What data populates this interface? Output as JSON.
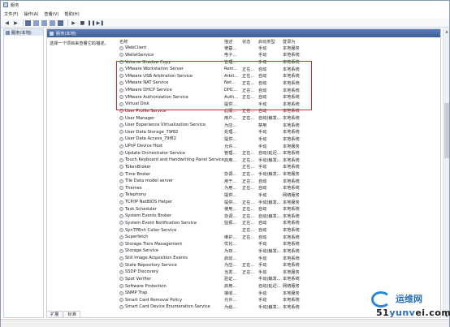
{
  "window": {
    "title": "服务"
  },
  "menu": [
    "文件(F)",
    "操作(A)",
    "查看(V)",
    "帮助(H)"
  ],
  "left_pane": {
    "item": "服务(本地)"
  },
  "header_band": {
    "title": "服务(本地)"
  },
  "description_hint": "选择一个项目来查看它的描述。",
  "columns": {
    "name": "名称",
    "desc": "描述",
    "status": "状态",
    "startup": "启动类型",
    "logon": "登录为"
  },
  "services": [
    {
      "name": "WebClient",
      "desc": "使基...",
      "status": "",
      "startup": "手动",
      "logon": "本地服务"
    },
    {
      "name": "WalletService",
      "desc": "电子...",
      "status": "",
      "startup": "手动",
      "logon": "本地系统"
    },
    {
      "name": "Volume Shadow Copy",
      "desc": "管理...",
      "status": "",
      "startup": "手动",
      "logon": "本地系统"
    },
    {
      "name": "VMware Workstation Server",
      "desc": "Rem...",
      "status": "正在...",
      "startup": "自动",
      "logon": "本地系统"
    },
    {
      "name": "VMware USB Arbitration Service",
      "desc": "Arbit...",
      "status": "正在...",
      "startup": "自动",
      "logon": "本地系统"
    },
    {
      "name": "VMware NAT Service",
      "desc": "Net...",
      "status": "正在...",
      "startup": "自动",
      "logon": "本地系统"
    },
    {
      "name": "VMware DHCP Service",
      "desc": "DHC...",
      "status": "正在...",
      "startup": "自动",
      "logon": "本地系统"
    },
    {
      "name": "VMware Authorization Service",
      "desc": "Auth...",
      "status": "正在...",
      "startup": "自动",
      "logon": "本地系统"
    },
    {
      "name": "Virtual Disk",
      "desc": "提供...",
      "status": "",
      "startup": "手动",
      "logon": "本地系统"
    },
    {
      "name": "User Profile Service",
      "desc": "此服...",
      "status": "正在...",
      "startup": "自动",
      "logon": "本地系统"
    },
    {
      "name": "User Manager",
      "desc": "用户...",
      "status": "正在...",
      "startup": "自动(触发...",
      "logon": "本地系统"
    },
    {
      "name": "User Experience Virtualization Service",
      "desc": "为应...",
      "status": "",
      "startup": "禁用",
      "logon": "本地系统"
    },
    {
      "name": "User Data Storage_79f82",
      "desc": "处理...",
      "status": "",
      "startup": "手动",
      "logon": "本地系统"
    },
    {
      "name": "User Data Access_79f82",
      "desc": "提供...",
      "status": "",
      "startup": "手动",
      "logon": "本地系统"
    },
    {
      "name": "UPnP Device Host",
      "desc": "允许...",
      "status": "",
      "startup": "手动",
      "logon": "本地服务"
    },
    {
      "name": "Update Orchestrator Service",
      "desc": "管理...",
      "status": "正在...",
      "startup": "自动(延迟...",
      "logon": "本地系统"
    },
    {
      "name": "Touch Keyboard and Handwriting Panel Service",
      "desc": "启用...",
      "status": "正在...",
      "startup": "手动(触发...",
      "logon": "本地系统"
    },
    {
      "name": "TokenBroker",
      "desc": "",
      "status": "正在...",
      "startup": "手动",
      "logon": "本地系统"
    },
    {
      "name": "Time Broker",
      "desc": "协调...",
      "status": "正在...",
      "startup": "手动(触发...",
      "logon": "本地服务"
    },
    {
      "name": "Tile Data model server",
      "desc": "用于...",
      "status": "正在...",
      "startup": "自动",
      "logon": "本地系统"
    },
    {
      "name": "Themes",
      "desc": "为用...",
      "status": "正在...",
      "startup": "自动",
      "logon": "本地系统"
    },
    {
      "name": "Telephony",
      "desc": "提供...",
      "status": "",
      "startup": "手动",
      "logon": "网络服务"
    },
    {
      "name": "TCP/IP NetBIOS Helper",
      "desc": "提供...",
      "status": "正在...",
      "startup": "手动(触发...",
      "logon": "本地服务"
    },
    {
      "name": "Task Scheduler",
      "desc": "使用...",
      "status": "正在...",
      "startup": "自动",
      "logon": "本地系统"
    },
    {
      "name": "System Events Broker",
      "desc": "协调...",
      "status": "正在...",
      "startup": "自动(触发...",
      "logon": "本地系统"
    },
    {
      "name": "System Event Notification Service",
      "desc": "监视...",
      "status": "正在...",
      "startup": "自动",
      "logon": "本地系统"
    },
    {
      "name": "SynTPEnh Caller Service",
      "desc": "",
      "status": "正在...",
      "startup": "自动",
      "logon": "本地系统"
    },
    {
      "name": "Superfetch",
      "desc": "维护...",
      "status": "正在...",
      "startup": "自动",
      "logon": "本地系统"
    },
    {
      "name": "Storage Tiers Management",
      "desc": "优化...",
      "status": "",
      "startup": "手动",
      "logon": "本地系统"
    },
    {
      "name": "Storage Service",
      "desc": "为存...",
      "status": "",
      "startup": "手动(触发...",
      "logon": "本地系统"
    },
    {
      "name": "Still Image Acquisition Events",
      "desc": "启动...",
      "status": "",
      "startup": "手动",
      "logon": "本地系统"
    },
    {
      "name": "State Repository Service",
      "desc": "为应...",
      "status": "正在...",
      "startup": "手动",
      "logon": "本地系统"
    },
    {
      "name": "SSDP Discovery",
      "desc": "当发...",
      "status": "正在...",
      "startup": "手动",
      "logon": "本地服务"
    },
    {
      "name": "Spot Verifier",
      "desc": "验证...",
      "status": "",
      "startup": "手动(触发...",
      "logon": "本地系统"
    },
    {
      "name": "Software Protection",
      "desc": "启用...",
      "status": "",
      "startup": "自动(延迟...",
      "logon": "网络服务"
    },
    {
      "name": "SNMP Trap",
      "desc": "接收...",
      "status": "",
      "startup": "手动",
      "logon": "本地服务"
    },
    {
      "name": "Smart Card Removal Policy",
      "desc": "允许...",
      "status": "",
      "startup": "手动",
      "logon": "本地系统"
    },
    {
      "name": "Smart Card Device Enumeration Service",
      "desc": "为给...",
      "status": "",
      "startup": "手动(触发...",
      "logon": "本地系统"
    }
  ],
  "tabs": [
    "扩展",
    "标准"
  ],
  "watermark": {
    "brand": "运维网",
    "site_left": "51",
    "site_mid": "yunv",
    "site_right": "ei.com"
  },
  "colors": {
    "highlight_box": "#e0262a",
    "header_band": "#3e5f98",
    "watermark": "#2a6fb8"
  }
}
